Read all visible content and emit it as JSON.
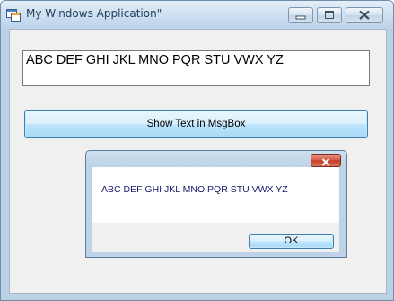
{
  "window": {
    "title": "My Windows Application\""
  },
  "main": {
    "textbox_value": "ABC DEF GHI JKL  MNO PQR STU VWX YZ",
    "show_button_label": "Show Text in MsgBox"
  },
  "msgbox": {
    "message": "ABC DEF GHI JKL  MNO PQR STU VWX YZ",
    "ok_label": "OK"
  },
  "icons": {
    "app": "app-icon",
    "minimize": "minimize-icon",
    "maximize": "maximize-icon",
    "close": "close-icon"
  },
  "colors": {
    "titlebar": "#cfe0f1",
    "button_border": "#3c7fb1",
    "close_button": "#c13d24",
    "message_text": "#1a1a6e"
  }
}
